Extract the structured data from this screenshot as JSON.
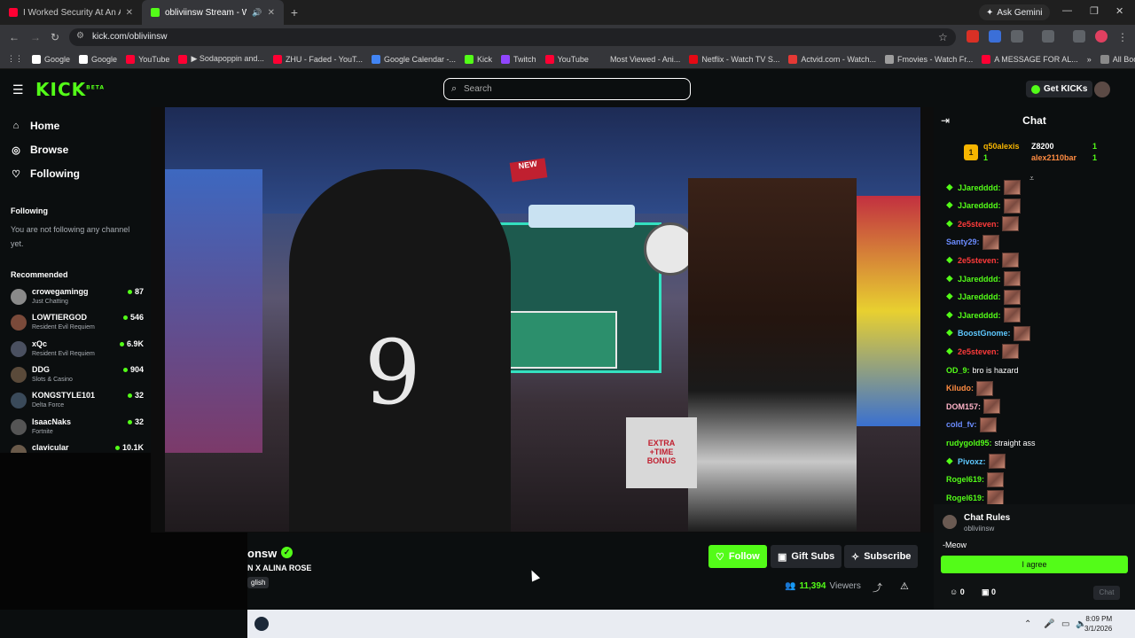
{
  "browser": {
    "tabs": [
      {
        "title": "I Worked Security At An Aband",
        "favicon_color": "#ff0033"
      },
      {
        "title": "obliviinsw Stream - Watch",
        "favicon_color": "#53fc18"
      }
    ],
    "ask_gemini": "Ask Gemini",
    "url": "kick.com/obliviinsw",
    "bookmarks": [
      {
        "label": "Google",
        "color": "#ffffff"
      },
      {
        "label": "Google",
        "color": "#ffffff"
      },
      {
        "label": "YouTube",
        "color": "#ff0033"
      },
      {
        "label": "▶ Sodapoppin and...",
        "color": "#ff0033"
      },
      {
        "label": "ZHU - Faded - YouT...",
        "color": "#ff0033"
      },
      {
        "label": "Google Calendar -...",
        "color": "#4285f4"
      },
      {
        "label": "Kick",
        "color": "#53fc18"
      },
      {
        "label": "Twitch",
        "color": "#9146ff"
      },
      {
        "label": "YouTube",
        "color": "#ff0033"
      },
      {
        "label": "Most Viewed - Ani...",
        "color": "#35363a"
      },
      {
        "label": "Netflix - Watch TV S...",
        "color": "#e50914"
      },
      {
        "label": "Actvid.com - Watch...",
        "color": "#e53935"
      },
      {
        "label": "Fmovies - Watch Fr...",
        "color": "#9e9e9e"
      },
      {
        "label": "A MESSAGE FOR AL...",
        "color": "#ff0033"
      }
    ],
    "all_bookmarks": "All Bookmarks"
  },
  "kick": {
    "logo": "KICK",
    "logo_sup": "BETA",
    "search_placeholder": "Search",
    "get_kicks": "Get KICKs"
  },
  "sidebar": {
    "nav": [
      {
        "label": "Home",
        "icon": "home-icon"
      },
      {
        "label": "Browse",
        "icon": "compass-icon"
      },
      {
        "label": "Following",
        "icon": "heart-icon"
      }
    ],
    "following_header": "Following",
    "following_note": "You are not following any channel yet.",
    "recommended_header": "Recommended",
    "recommended": [
      {
        "name": "crowegamingg",
        "category": "Just Chatting",
        "viewers": "87",
        "color": "#8a8a8a"
      },
      {
        "name": "LOWTIERGOD",
        "category": "Resident Evil Requiem",
        "viewers": "546",
        "color": "#7a4a3a"
      },
      {
        "name": "xQc",
        "category": "Resident Evil Requiem",
        "viewers": "6.9K",
        "color": "#4a5060"
      },
      {
        "name": "DDG",
        "category": "Slots & Casino",
        "viewers": "904",
        "color": "#5a4a3a"
      },
      {
        "name": "KONGSTYLE101",
        "category": "Delta Force",
        "viewers": "32",
        "color": "#3a4a5a"
      },
      {
        "name": "IsaacNaks",
        "category": "Fortnite",
        "viewers": "32",
        "color": "#555555"
      },
      {
        "name": "clavicular",
        "category": "",
        "viewers": "10.1K",
        "color": "#6a5a4a"
      }
    ]
  },
  "stream": {
    "channel_name_visible": "onsw",
    "title_visible": "N X ALINA ROSE",
    "language_visible": "glish",
    "follow": "Follow",
    "gift_subs": "Gift Subs",
    "subscribe": "Subscribe",
    "viewers_count": "11,394",
    "viewers_label": "Viewers"
  },
  "chat": {
    "title": "Chat",
    "pinned": {
      "badge": "1",
      "user1": "q50alexis",
      "user1_count": "1",
      "user2": "Z8200",
      "user2_count": "1",
      "user3": "alex2110bar",
      "user3_count": "1"
    },
    "messages": [
      {
        "user": "JJaredddd:",
        "color": "#53fc18",
        "badge": true,
        "text": "",
        "emote": true
      },
      {
        "user": "JJaredddd:",
        "color": "#53fc18",
        "badge": true,
        "text": "",
        "emote": true
      },
      {
        "user": "2e5steven:",
        "color": "#ff3b3b",
        "badge": true,
        "text": "",
        "emote": true
      },
      {
        "user": "Santy29:",
        "color": "#6b8cff",
        "badge": false,
        "text": "",
        "emote": true
      },
      {
        "user": "2e5steven:",
        "color": "#ff3b3b",
        "badge": true,
        "text": "",
        "emote": true
      },
      {
        "user": "JJaredddd:",
        "color": "#53fc18",
        "badge": true,
        "text": "",
        "emote": true
      },
      {
        "user": "JJaredddd:",
        "color": "#53fc18",
        "badge": true,
        "text": "",
        "emote": true
      },
      {
        "user": "JJaredddd:",
        "color": "#53fc18",
        "badge": true,
        "text": "",
        "emote": true
      },
      {
        "user": "BoostGnome:",
        "color": "#5ec8ff",
        "badge": true,
        "text": "",
        "emote": true
      },
      {
        "user": "2e5steven:",
        "color": "#ff3b3b",
        "badge": true,
        "text": "",
        "emote": true
      },
      {
        "user": "OD_9:",
        "color": "#53fc18",
        "badge": false,
        "text": "bro is hazard",
        "emote": false
      },
      {
        "user": "Kiludo:",
        "color": "#ff8c42",
        "badge": false,
        "text": "",
        "emote": true
      },
      {
        "user": "DOM157:",
        "color": "#ffb3c8",
        "badge": false,
        "text": "",
        "emote": true
      },
      {
        "user": "cold_fv:",
        "color": "#6b8cff",
        "badge": false,
        "text": "",
        "emote": true
      },
      {
        "user": "rudygold95:",
        "color": "#53fc18",
        "badge": false,
        "text": "straight ass",
        "emote": false
      },
      {
        "user": "Pivoxz:",
        "color": "#5ec8ff",
        "badge": true,
        "text": "",
        "emote": true
      },
      {
        "user": "Rogel619:",
        "color": "#53fc18",
        "badge": false,
        "text": "",
        "emote": true
      },
      {
        "user": "Rogel619:",
        "color": "#53fc18",
        "badge": false,
        "text": "",
        "emote": true
      }
    ],
    "rules": {
      "title": "Chat Rules",
      "channel": "obliviinsw",
      "text": "-Meow",
      "agree": "I agree"
    },
    "footer": {
      "count1": "0",
      "count2": "0",
      "send": "Chat"
    }
  },
  "taskbar": {
    "time": "8:09 PM",
    "date": "3/1/2026"
  },
  "colors": {
    "kick_green": "#53fc18",
    "background": "#0b0e0f",
    "panel": "#24272c"
  }
}
